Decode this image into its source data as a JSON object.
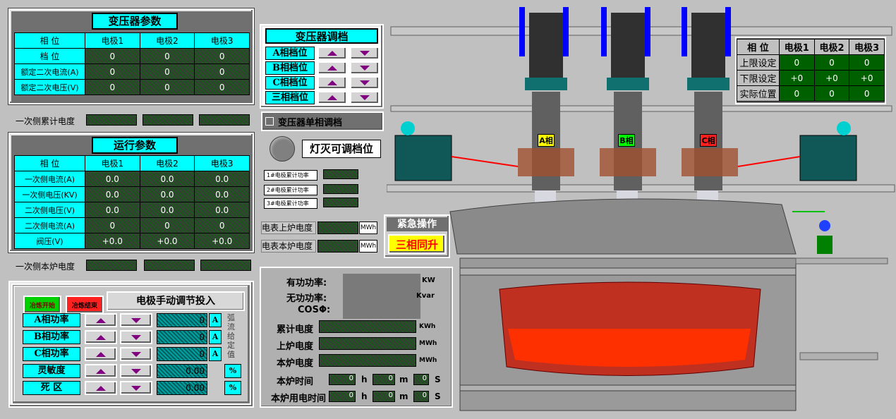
{
  "transformer_params": {
    "title": "变压器参数",
    "headers": [
      "相 位",
      "电极1",
      "电极2",
      "电极3"
    ],
    "rows": [
      {
        "label": "档 位",
        "values": [
          "0",
          "0",
          "0"
        ]
      },
      {
        "label": "额定二次电流(A)",
        "values": [
          "0",
          "0",
          "0"
        ]
      },
      {
        "label": "额定二次电压(V)",
        "values": [
          "0",
          "0",
          "0"
        ]
      }
    ]
  },
  "primary_cumulative_label": "一次侧累计电度",
  "run_params": {
    "title": "运行参数",
    "headers": [
      "相 位",
      "电极1",
      "电极2",
      "电极3"
    ],
    "rows": [
      {
        "label": "一次侧电流(A)",
        "values": [
          "0.0",
          "0.0",
          "0.0"
        ]
      },
      {
        "label": "一次侧电压(KV)",
        "values": [
          "0.0",
          "0.0",
          "0.0"
        ]
      },
      {
        "label": "二次侧电压(V)",
        "values": [
          "0.0",
          "0.0",
          "0.0"
        ]
      },
      {
        "label": "二次侧电流(A)",
        "values": [
          "0",
          "0",
          "0"
        ]
      },
      {
        "label": "阀压(V)",
        "values": [
          "+0.0",
          "+0.0",
          "+0.0"
        ]
      }
    ]
  },
  "primary_furnace_label": "一次侧本炉电度",
  "manual_adjust": {
    "title": "电极手动调节投入",
    "start_btn": "冶炼开始",
    "end_btn": "冶炼结束",
    "rows": [
      {
        "label": "A相功率",
        "value": "0",
        "unit": "A"
      },
      {
        "label": "B相功率",
        "value": "0",
        "unit": "A"
      },
      {
        "label": "C相功率",
        "value": "0",
        "unit": "A"
      },
      {
        "label": "灵敏度",
        "value": "0.00",
        "unit": "%"
      },
      {
        "label": "死 区",
        "value": "0.00",
        "unit": "%"
      }
    ],
    "side_label": "弧流给定值"
  },
  "tap_adjust": {
    "title": "变压器调档",
    "rows": [
      "A相档位",
      "B相档位",
      "C相档位",
      "三相档位"
    ],
    "single_phase_label": "变压器单相调档"
  },
  "lamp_label": "灯灭可调档位",
  "small_meters": [
    "1#电极累计功率",
    "2#电极累计功率",
    "3#电极累计功率"
  ],
  "meter_upper": {
    "label": "电表上炉电度",
    "unit": "MWh"
  },
  "meter_current": {
    "label": "电表本炉电度",
    "unit": "MWh"
  },
  "emergency": {
    "title": "紧急操作",
    "button": "三相同升"
  },
  "power_panel": {
    "active_power": {
      "label": "有功功率:",
      "unit": "KW"
    },
    "reactive_power": {
      "label": "无功功率:",
      "unit": "Kvar"
    },
    "cos_phi": {
      "label": "COSΦ:"
    },
    "cumulative": {
      "label": "累计电度",
      "unit": "KWh"
    },
    "upper": {
      "label": "上炉电度",
      "unit": "MWh"
    },
    "current": {
      "label": "本炉电度",
      "unit": "MWh"
    },
    "furnace_time": {
      "label": "本炉时间",
      "h": "0",
      "m": "0",
      "s": "0",
      "hu": "h",
      "mu": "m",
      "su": "S"
    },
    "power_time": {
      "label": "本炉用电时间",
      "h": "0",
      "m": "0",
      "s": "0",
      "hu": "h",
      "mu": "m",
      "su": "S"
    }
  },
  "limits_table": {
    "headers": [
      "相 位",
      "电极1",
      "电极2",
      "电极3"
    ],
    "rows": [
      {
        "label": "上限设定",
        "values": [
          "0",
          "0",
          "0"
        ]
      },
      {
        "label": "下限设定",
        "values": [
          "+0",
          "+0",
          "+0"
        ]
      },
      {
        "label": "实际位置",
        "values": [
          "0",
          "0",
          "0"
        ]
      }
    ]
  },
  "phase_labels": [
    "A相",
    "B相",
    "C相"
  ],
  "colors": {
    "cyan": "#00ffff",
    "green": "#00c000",
    "red": "#ff2020",
    "yellow": "#ffff00",
    "purple": "#800080"
  }
}
